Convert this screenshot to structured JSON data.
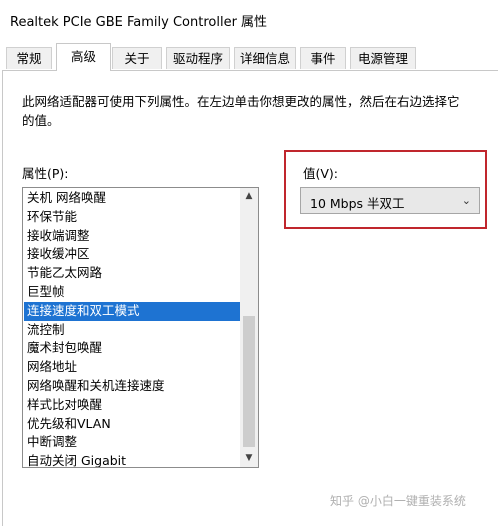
{
  "window": {
    "title": "Realtek PCIe GBE Family Controller 属性"
  },
  "tabs": [
    {
      "label": "常规"
    },
    {
      "label": "高级"
    },
    {
      "label": "关于"
    },
    {
      "label": "驱动程序"
    },
    {
      "label": "详细信息"
    },
    {
      "label": "事件"
    },
    {
      "label": "电源管理"
    }
  ],
  "active_tab": "高级",
  "description": "此网络适配器可使用下列属性。在左边单击你想更改的属性，然后在右边选择它的值。",
  "property": {
    "label": "属性(P):",
    "items": [
      "关机 网络唤醒",
      "环保节能",
      "接收端调整",
      "接收缓冲区",
      "节能乙太网路",
      "巨型帧",
      "连接速度和双工模式",
      "流控制",
      "魔术封包唤醒",
      "网络地址",
      "网络唤醒和关机连接速度",
      "样式比对唤醒",
      "优先级和VLAN",
      "中断调整",
      "自动关闭 Gigabit"
    ],
    "selected": "连接速度和双工模式"
  },
  "value": {
    "label": "值(V):",
    "selected": "10 Mbps 半双工"
  },
  "icons": {
    "scroll_up": "▲",
    "scroll_down": "▼",
    "dropdown": "⌄"
  },
  "colors": {
    "selection": "#1e73d2",
    "highlight_frame": "#c0262d"
  },
  "watermark": {
    "text": "知乎 @小白一键重装系统"
  }
}
